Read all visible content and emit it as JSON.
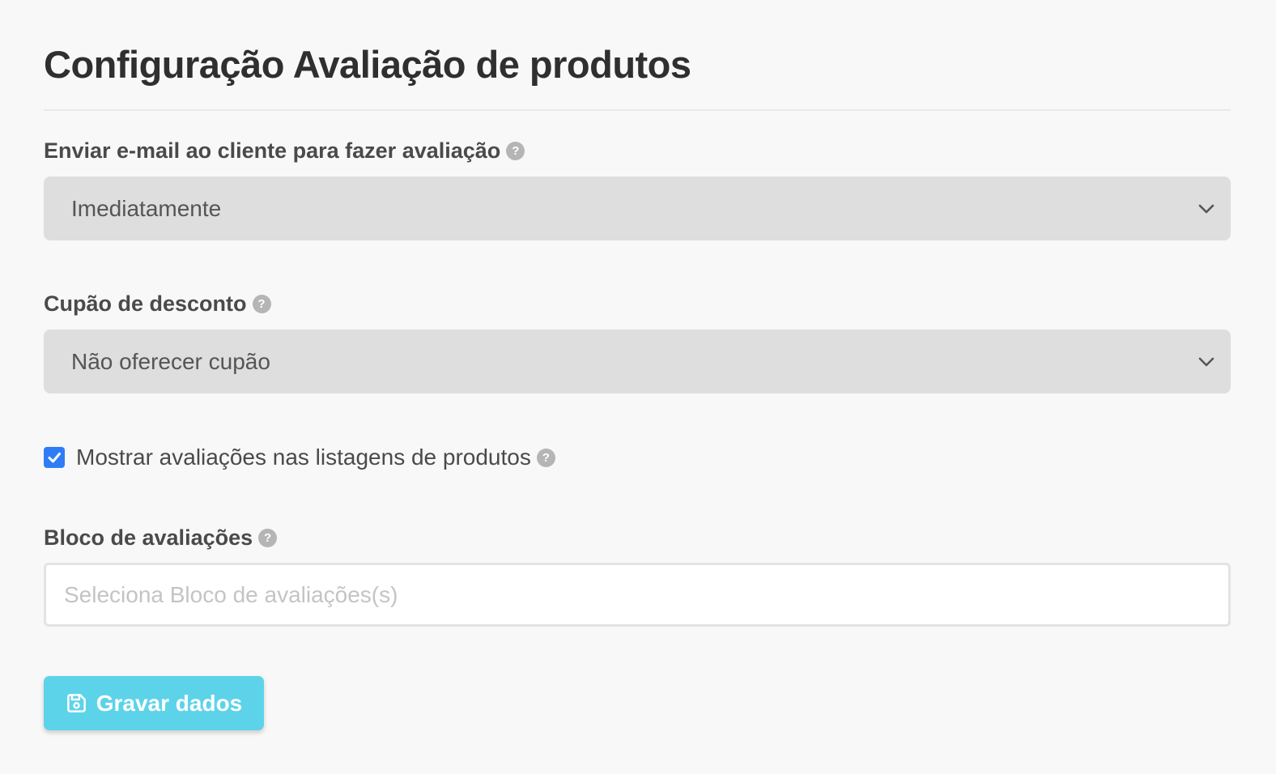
{
  "page": {
    "title": "Configuração Avaliação de produtos"
  },
  "send_email": {
    "label": "Enviar e-mail ao cliente para fazer avaliação",
    "help": "?",
    "selected": "Imediatamente"
  },
  "coupon": {
    "label": "Cupão de desconto",
    "help": "?",
    "selected": "Não oferecer cupão"
  },
  "show_reviews": {
    "label": "Mostrar avaliações nas listagens de produtos",
    "help": "?",
    "checked": true
  },
  "review_block": {
    "label": "Bloco de avaliações",
    "help": "?",
    "value": "",
    "placeholder": "Seleciona Bloco de avaliações(s)"
  },
  "save_button": {
    "label": "Gravar dados",
    "icon": "save-icon"
  },
  "colors": {
    "background": "#f8f8f8",
    "select_background": "#dedede",
    "checkbox": "#2f7df6",
    "button": "#5dd3ea"
  }
}
